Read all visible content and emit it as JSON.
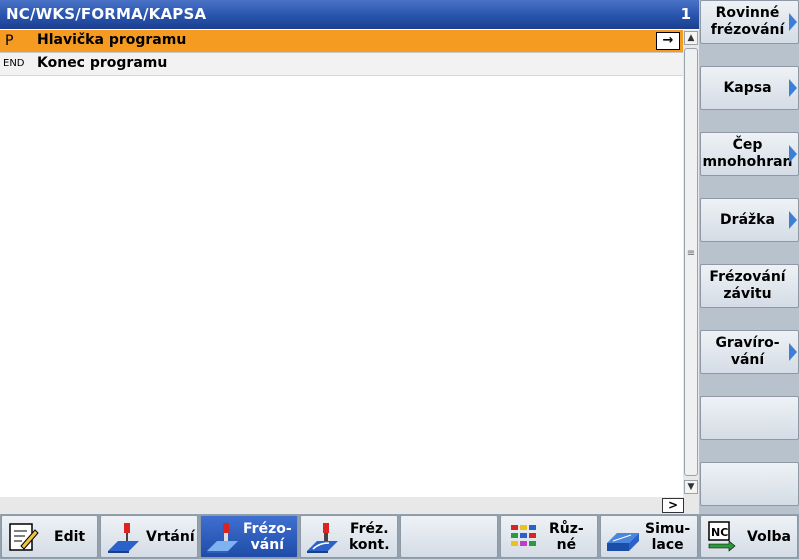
{
  "editor": {
    "title_path": "NC/WKS/FORMA/KAPSA",
    "channel_number": "1",
    "rows": [
      {
        "tag": "P",
        "text": "Hlavička programu",
        "selected": true,
        "action_icon": "→"
      },
      {
        "tag": "END",
        "text": "Konec programu",
        "selected": false
      }
    ],
    "hscroll_label": ">"
  },
  "vertical_softkeys": [
    {
      "label": "Rovinné\nfrézování",
      "has_submenu": true
    },
    {
      "label": "Kapsa",
      "has_submenu": true
    },
    {
      "label": "Čep\nmnohohran",
      "has_submenu": true
    },
    {
      "label": "Drážka",
      "has_submenu": true
    },
    {
      "label": "Frézování\nzávitu",
      "has_submenu": false
    },
    {
      "label": "Gravíro-\nvání",
      "has_submenu": true
    },
    {
      "label": "",
      "has_submenu": false
    },
    {
      "label": "",
      "has_submenu": false
    }
  ],
  "horizontal_softkeys": [
    {
      "label": "Edit",
      "icon": "edit-icon",
      "active": false
    },
    {
      "label": "Vrtání",
      "icon": "drilling-icon",
      "active": false
    },
    {
      "label": "Frézo-\nvání",
      "icon": "milling-icon",
      "active": true
    },
    {
      "label": "Fréz.\nkont.",
      "icon": "contour-milling-icon",
      "active": false
    },
    {
      "label": "",
      "icon": "",
      "active": false
    },
    {
      "label": "Růz-\nné",
      "icon": "misc-icon",
      "active": false
    },
    {
      "label": "Simu-\nlace",
      "icon": "simulation-icon",
      "active": false
    },
    {
      "label": "Volba",
      "icon": "nc-select-icon",
      "active": false
    }
  ],
  "colors": {
    "title_bar": "#2854ad",
    "selected_row": "#f59b21",
    "active_softkey": "#1f4ca8",
    "submenu_arrow": "#3d7fd6"
  }
}
